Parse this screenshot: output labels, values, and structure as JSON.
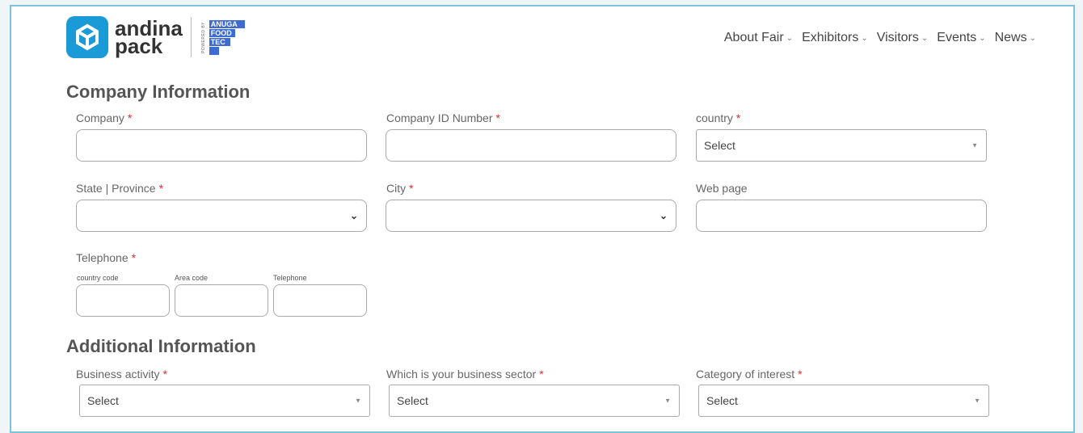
{
  "header": {
    "logo_line1": "andina",
    "logo_line2": "pack",
    "powered_by": "POWERED BY",
    "anuga": [
      "ANUGA",
      "FOOD",
      "TEC"
    ],
    "nav": [
      "About Fair",
      "Exhibitors",
      "Visitors",
      "Events",
      "News"
    ],
    "chevron": "⌄"
  },
  "company": {
    "heading": "Company Information",
    "company_label": "Company",
    "company_id_label": "Company ID Number",
    "country_label": "country",
    "country_value": "Select",
    "state_label": "State | Province",
    "city_label": "City",
    "web_label": "Web page",
    "telephone_label": "Telephone",
    "country_code_label": "country code",
    "area_code_label": "Area code",
    "telephone_sub_label": "Telephone",
    "required_mark": "*"
  },
  "additional": {
    "heading": "Additional Information",
    "business_activity_label": "Business activity",
    "business_sector_label": "Which is your business sector",
    "category_label": "Category of interest",
    "select_value": "Select"
  }
}
